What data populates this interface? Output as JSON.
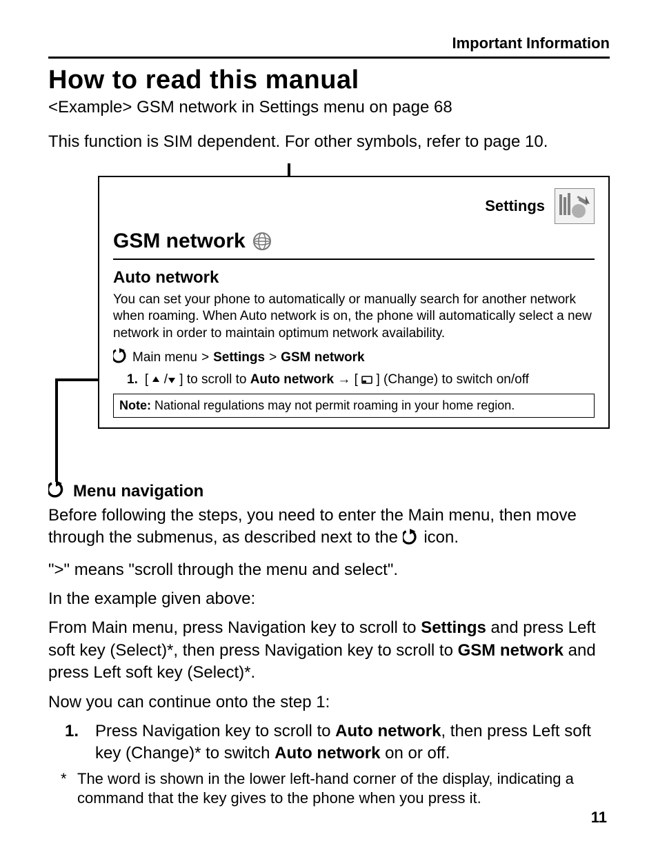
{
  "header": {
    "section": "Important Information"
  },
  "title": "How to read this manual",
  "intro_example": "<Example> GSM network in Settings menu on page 68",
  "intro_sim": "This function is SIM dependent. For other symbols, refer to page 10.",
  "box": {
    "settings_label": "Settings",
    "gsm_title": "GSM network",
    "auto_title": "Auto network",
    "auto_desc": "You can set your phone to automatically or manually search for another network when roaming. When Auto network is on, the phone will automatically select a new network in order to maintain optimum network availability.",
    "nav_prefix": "Main menu",
    "nav_sep1": ">",
    "nav_part1": "Settings",
    "nav_sep2": ">",
    "nav_part2": "GSM network",
    "step_num": "1.",
    "step_body_pre": "[",
    "step_scroll": "] to scroll to ",
    "step_target": "Auto network",
    "step_arrow_then": " → [",
    "step_change": "] (Change) to switch on/off",
    "note_label": "Note:",
    "note_text": " National regulations may not permit roaming in your home region."
  },
  "menu_nav": {
    "heading": "Menu navigation",
    "p1_a": "Before following the steps, you need to enter the Main menu, then move through the submenus, as described next to the ",
    "p1_b": " icon.",
    "p2": "\">\" means \"scroll through the menu and select\".",
    "p3": "In the example given above:",
    "p4_a": "From Main menu, press Navigation key to scroll to ",
    "p4_b": "Settings",
    "p4_c": " and press Left soft key (Select)*, then press Navigation key to scroll to ",
    "p4_d": "GSM network",
    "p4_e": " and press Left soft key (Select)*.",
    "p5": "Now you can continue onto the step 1:",
    "step_num": "1.",
    "step_a": "Press Navigation key to scroll to ",
    "step_b": "Auto network",
    "step_c": ", then press Left soft key (Change)* to switch ",
    "step_d": "Auto network",
    "step_e": " on or off.",
    "foot_star": "*",
    "foot_text": "The word is shown in the lower left-hand corner of the display, indicating a command that the key gives to the phone when you press it."
  },
  "page_number": "11"
}
